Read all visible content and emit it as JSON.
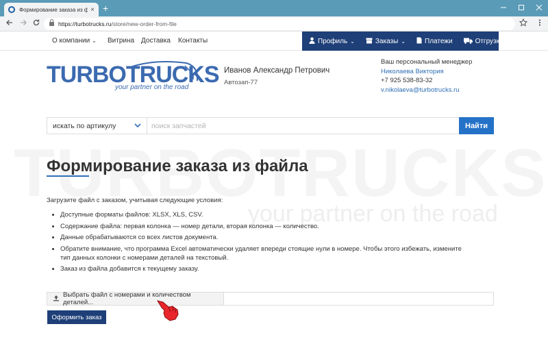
{
  "browser": {
    "tab_title": "Формирование заказа из фай...",
    "tab_close": "×",
    "new_tab": "+",
    "url_host": "https://turbotrucks.ru",
    "url_path": "/store/new-order-from-file",
    "icons": [
      "back-icon",
      "forward-icon",
      "reload-icon",
      "lock-icon",
      "star-icon",
      "menu-icon"
    ]
  },
  "nav": {
    "about": "О компании",
    "showcase": "Витрина",
    "delivery": "Доставка",
    "contacts": "Контакты"
  },
  "account": {
    "profile": "Профиль",
    "orders": "Заказы",
    "payments": "Платежи",
    "shipments": "Отгрузки"
  },
  "logo": {
    "word": "TURBOTRUCKS",
    "tagline": "your partner on the road"
  },
  "user": {
    "name": "Иванов Александр Петрович",
    "company": "Автозап-77"
  },
  "manager": {
    "title": "Ваш персональный менеджер",
    "name": "Николаева Виктория",
    "phone": "+7 925 538-83-32",
    "email": "v.nikolaeva@turbotrucks.ru"
  },
  "search": {
    "mode": "искать по артикулу",
    "placeholder": "поиск запчастей",
    "button": "Найти"
  },
  "watermark": {
    "word": "TURBOTRUCKS",
    "tagline": "your partner on the road"
  },
  "page": {
    "title": "Формирование заказа из файла",
    "intro": "Загрузите файл с заказом, учитывая следующие условия:",
    "conditions": [
      "Доступные форматы файлов: XLSX, XLS, CSV.",
      "Содержание файла: первая колонка — номер детали, вторая колонка — количество.",
      "Данные обрабатываются со всех листов документа.",
      "Обратите внимание, что программа Excel автоматически удаляет впереди стоящие нули в номере. Чтобы этого избежать, измените тип данных колонки с номерами деталей на текстовый.",
      "Заказ из файла добавится к текущему заказу."
    ],
    "file_button": "Выбрать файл с номерами и количеством деталей...",
    "submit": "Оформить заказ"
  },
  "colors": {
    "accent": "#1e3f78",
    "link": "#2f6fb3",
    "search_button": "#2472c8",
    "tabbar": "#5a9bb8"
  }
}
